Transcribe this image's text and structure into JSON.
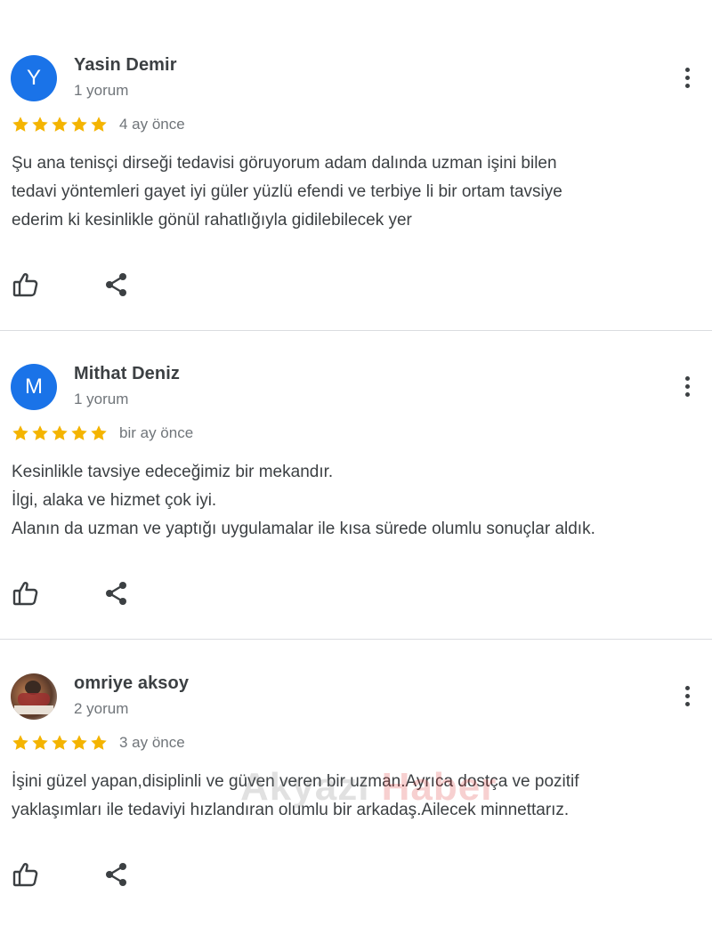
{
  "reviews": [
    {
      "avatar_letter": "Y",
      "avatar_color": "#1a73e8",
      "name": "Yasin Demir",
      "review_count": "1 yorum",
      "stars": 5,
      "time": "4 ay önce",
      "text_lines": [
        "Şu ana tenisçi dirseği tedavisi göruyorum adam dalında uzman işini bilen",
        "tedavi yöntemleri gayet iyi güler yüzlü efendi ve terbiye li bir ortam tavsiye",
        "ederim ki kesinlikle gönül rahatlığıyla gidilebilecek yer"
      ]
    },
    {
      "avatar_letter": "M",
      "avatar_color": "#1a73e8",
      "name": "Mithat Deniz",
      "review_count": "1 yorum",
      "stars": 5,
      "time": "bir ay önce",
      "text_lines": [
        "Kesinlikle tavsiye edeceğimiz bir mekandır.",
        "İlgi, alaka ve hizmet çok iyi.",
        "Alanın da uzman ve yaptığı uygulamalar ile kısa sürede olumlu sonuçlar aldık."
      ]
    },
    {
      "avatar_letter": "",
      "avatar_color": "photo",
      "name": "omriye aksoy",
      "review_count": "2 yorum",
      "stars": 5,
      "time": "3 ay önce",
      "text_lines": [
        "İşini güzel yapan,disiplinli ve güven veren bir uzman.Ayrıca dostça ve pozitif",
        "yaklaşımları ile tedaviyi hızlandıran olumlu bir arkadaş.Ailecek minnettarız."
      ]
    }
  ],
  "watermark": {
    "part1": "Akyazı ",
    "part2": "Haber"
  },
  "icons": {
    "like": "thumbs-up-icon",
    "share": "share-icon",
    "menu": "more-vert-icon",
    "star": "star-icon"
  },
  "colors": {
    "star": "#f4b400",
    "avatar": "#1a73e8",
    "divider": "#dadce0"
  }
}
